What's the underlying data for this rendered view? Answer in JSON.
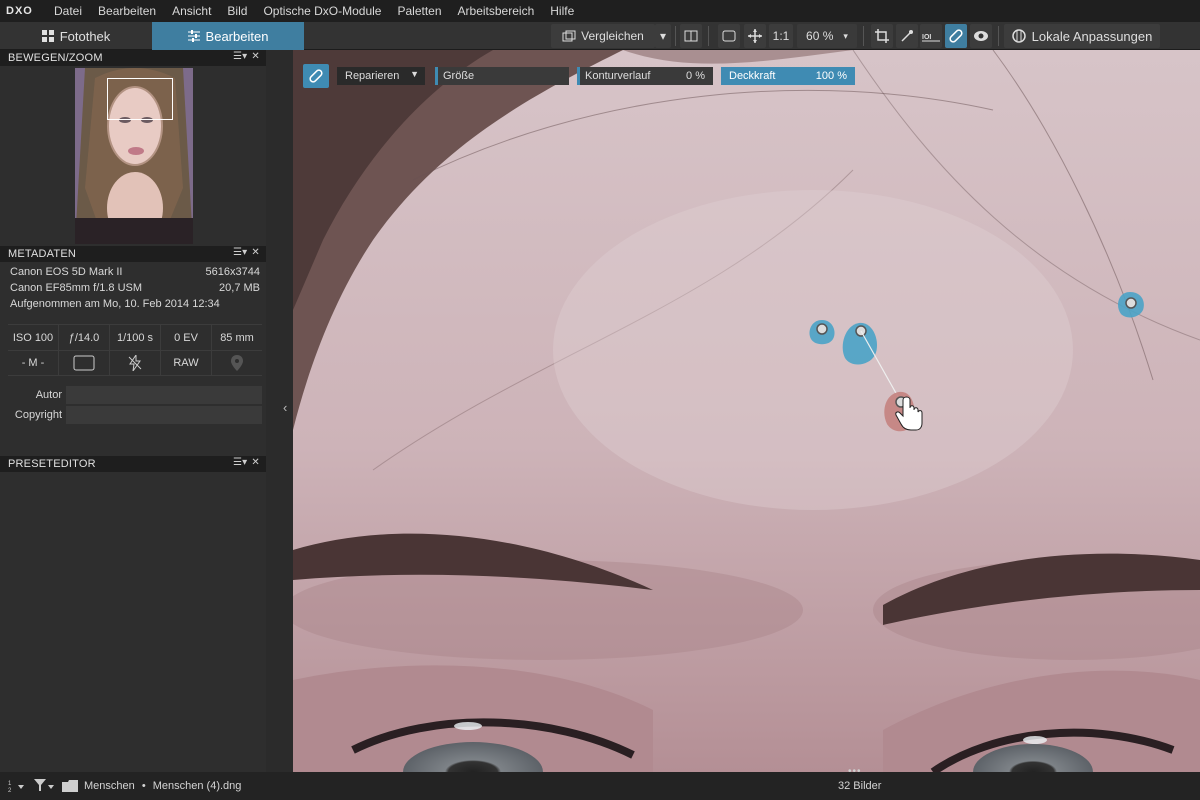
{
  "app": {
    "logo": "DXO"
  },
  "menu": [
    "Datei",
    "Bearbeiten",
    "Ansicht",
    "Bild",
    "Optische DxO-Module",
    "Paletten",
    "Arbeitsbereich",
    "Hilfe"
  ],
  "tabs": {
    "fotothek": "Fotothek",
    "bearbeiten": "Bearbeiten"
  },
  "toolbar": {
    "compare_label": "Vergleichen",
    "one_to_one": "1:1",
    "zoom": "60 %",
    "local_adjust_label": "Lokale Anpassungen"
  },
  "panels": {
    "navzoom": "BEWEGEN/ZOOM",
    "metadata": "METADATEN",
    "preset": "PRESETEDITOR"
  },
  "metadata": {
    "camera": "Canon EOS 5D Mark II",
    "dimensions": "5616x3744",
    "lens": "Canon EF85mm f/1.8 USM",
    "filesize": "20,7 MB",
    "taken": "Aufgenommen am Mo, 10. Feb 2014 12:34",
    "exif": [
      "ISO 100",
      "ƒ/14.0",
      "1/100 s",
      "0 EV",
      "85 mm"
    ],
    "mode": "- M -",
    "format": "RAW",
    "author_label": "Autor",
    "copyright_label": "Copyright"
  },
  "repair": {
    "mode": "Reparieren",
    "size_label": "Größe",
    "contour_label": "Konturverlauf",
    "contour_value": "0 %",
    "opacity_label": "Deckkraft",
    "opacity_value": "100 %"
  },
  "status": {
    "folder": "Menschen",
    "file": "Menschen (4).dng",
    "count": "32 Bilder"
  },
  "colors": {
    "accent": "#3f7ea0",
    "repair_source": "#4aa3c6",
    "repair_target": "#c4827f"
  }
}
